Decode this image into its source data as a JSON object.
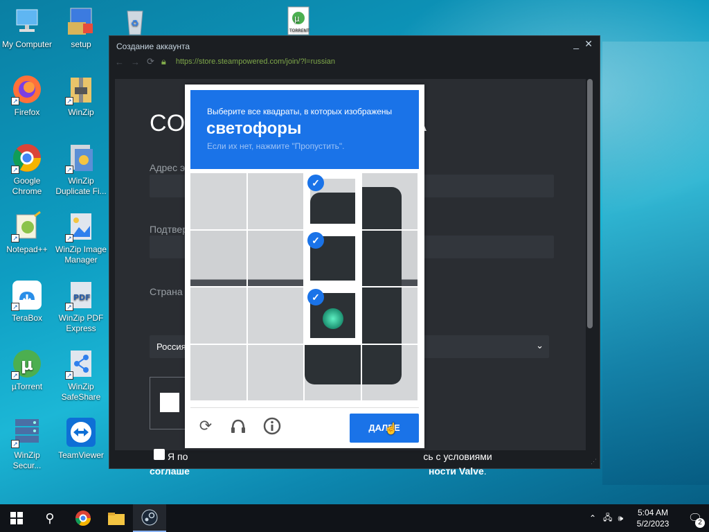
{
  "desktop": {
    "icons": [
      {
        "label": "My Computer",
        "icon": "computer-icon"
      },
      {
        "label": "setup",
        "icon": "installer-icon"
      },
      {
        "label": "",
        "icon": "recycle-bin-icon"
      },
      {
        "label": "",
        "icon": "torrent-file-icon"
      },
      {
        "label": "Firefox",
        "icon": "firefox-icon"
      },
      {
        "label": "WinZip",
        "icon": "winzip-icon"
      },
      {
        "label": "Google Chrome",
        "icon": "chrome-icon"
      },
      {
        "label": "WinZip Duplicate Fi...",
        "icon": "winzip-duplicate-icon"
      },
      {
        "label": "Notepad++",
        "icon": "notepadpp-icon"
      },
      {
        "label": "WinZip Image Manager",
        "icon": "winzip-image-icon"
      },
      {
        "label": "TeraBox",
        "icon": "terabox-icon"
      },
      {
        "label": "WinZip PDF Express",
        "icon": "winzip-pdf-icon"
      },
      {
        "label": "µTorrent",
        "icon": "utorrent-icon"
      },
      {
        "label": "WinZip SafeShare",
        "icon": "winzip-safeshare-icon"
      },
      {
        "label": "WinZip Secur...",
        "icon": "winzip-secure-icon"
      },
      {
        "label": "TeamViewer",
        "icon": "teamviewer-icon"
      }
    ],
    "torrent_label": "TORRENT"
  },
  "steam_window": {
    "title": "Создание аккаунта",
    "url": "https://store.steampowered.com/join/?l=russian",
    "heading_left": "СО",
    "heading_right": "А",
    "email_label": "Адрес э",
    "confirm_label": "Подтвер",
    "country_label": "Страна",
    "country_value": "Россия",
    "agree_line1_left": "Я по",
    "agree_line1_right": "сь с условиями",
    "agree_line2_left": "соглаше",
    "agree_line2_right": "ности Valve",
    "agree_line2_end": "."
  },
  "captcha": {
    "instruction": "Выберите все квадраты, в которых изображены",
    "target": "светофоры",
    "skip_hint": "Если их нет, нажмите \"Пропустить\".",
    "submit_label": "ДАЛЕЕ",
    "selected_tiles": [
      2,
      6,
      10
    ],
    "total_tiles": 16
  },
  "taskbar": {
    "time": "5:04 AM",
    "date": "5/2/2023",
    "notification_count": "2"
  }
}
